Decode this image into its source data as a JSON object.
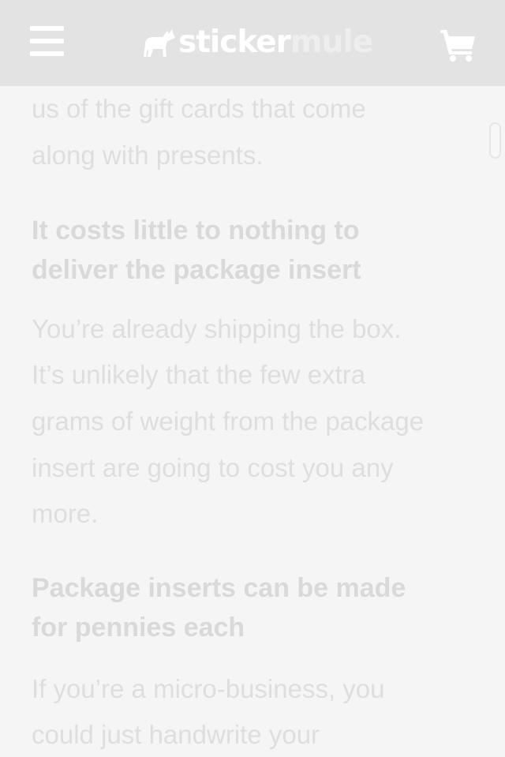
{
  "header": {
    "logo_part1": "sticker",
    "logo_part2": "mule",
    "menu_icon": "hamburger-menu-icon",
    "logo_icon": "mule-logo-icon",
    "cart_icon": "shopping-cart-icon"
  },
  "article": {
    "intro_lines": [
      "us of the gift cards that come",
      "along with presents."
    ],
    "section1": {
      "heading_lines": [
        "It costs little to nothing to",
        "deliver the package insert"
      ],
      "body_lines": [
        "You’re already shipping the box.",
        "It’s unlikely that the few extra",
        "grams of weight from the package",
        "insert are going to cost you any",
        "more."
      ]
    },
    "section2": {
      "heading_lines": [
        "Package inserts can be made",
        "for pennies each"
      ],
      "body_lines": [
        "If you’re a micro-business, you",
        "could just handwrite your"
      ]
    }
  },
  "colors": {
    "header_bg": "#e3e3e3",
    "page_bg": "#f5f5f5",
    "text": "#dedede",
    "heading": "#d9d9d9",
    "header_icons": "#ffffff"
  }
}
